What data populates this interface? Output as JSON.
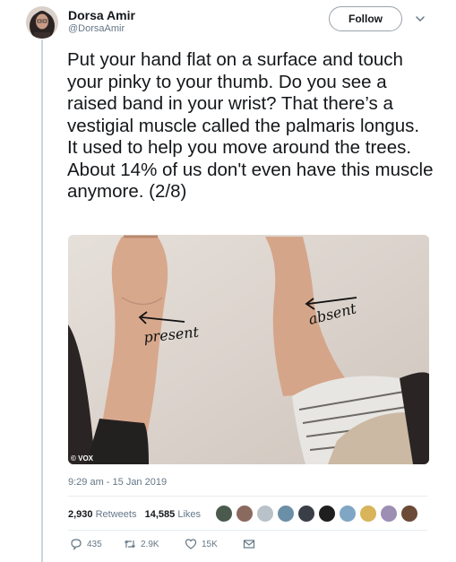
{
  "author": {
    "name": "Dorsa Amir",
    "handle": "@DorsaAmir"
  },
  "follow_label": "Follow",
  "tweet_text": "Put your hand flat on a surface and touch your pinky to your thumb. Do you see a raised band in your wrist? That there’s a vestigial muscle called the palmaris longus. It used to help you move around the trees. About 14% of us don't even have this muscle anymore. (2/8)",
  "photo": {
    "label_present": "present",
    "label_absent": "absent",
    "watermark": "VOX"
  },
  "timestamp": "9:29 am - 15 Jan 2019",
  "stats": {
    "retweets_count": "2,930",
    "retweets_label": "Retweets",
    "likes_count": "14,585",
    "likes_label": "Likes"
  },
  "actions": {
    "replies": "435",
    "retweets": "2.9K",
    "likes": "15K"
  },
  "colors": {
    "secondary_text": "#657786",
    "divider": "#e6ecf0",
    "border": "#9aa3aa"
  }
}
